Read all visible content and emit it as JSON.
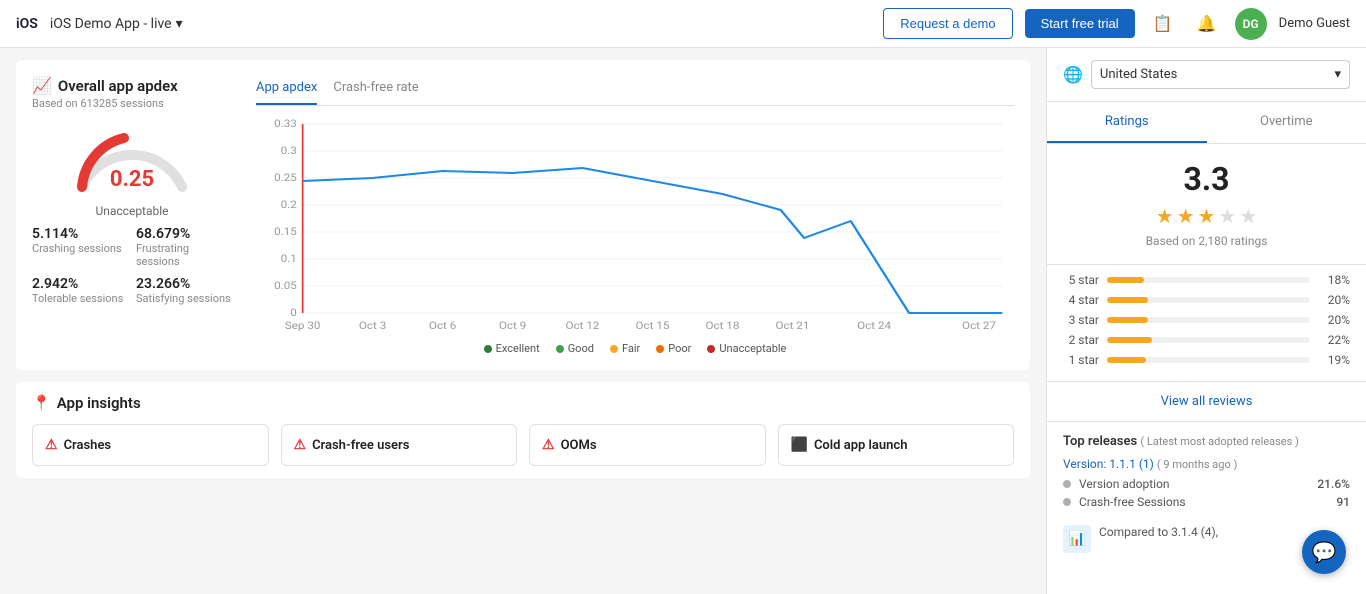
{
  "topnav": {
    "platform": "iOS",
    "app_name": "iOS Demo App - live",
    "demo_btn": "Request a demo",
    "trial_btn": "Start free trial",
    "user_initials": "DG",
    "user_name": "Demo Guest"
  },
  "apdex": {
    "title": "Overall app apdex",
    "subtitle": "Based on 613285 sessions",
    "value": "0.25",
    "label": "Unacceptable",
    "stats": [
      {
        "val": "5.114%",
        "lbl": "Crashing sessions"
      },
      {
        "val": "68.679%",
        "lbl": "Frustrating sessions"
      },
      {
        "val": "2.942%",
        "lbl": "Tolerable sessions"
      },
      {
        "val": "23.266%",
        "lbl": "Satisfying sessions"
      }
    ],
    "tabs": [
      {
        "label": "App apdex",
        "active": true
      },
      {
        "label": "Crash-free rate",
        "active": false
      }
    ],
    "x_labels": [
      "Sep 30",
      "Oct 3",
      "Oct 6",
      "Oct 9",
      "Oct 12",
      "Oct 15",
      "Oct 18",
      "Oct 21",
      "Oct 24",
      "Oct 27"
    ],
    "y_labels": [
      "0.33",
      "0.3",
      "0.25",
      "0.2",
      "0.15",
      "0.1",
      "0.05",
      "0"
    ],
    "legend": [
      {
        "label": "Excellent",
        "color": "#2e7d32"
      },
      {
        "label": "Good",
        "color": "#43a047"
      },
      {
        "label": "Fair",
        "color": "#f9a825"
      },
      {
        "label": "Poor",
        "color": "#ef6c00"
      },
      {
        "label": "Unacceptable",
        "color": "#c62828"
      }
    ]
  },
  "insights": {
    "title": "App insights",
    "cards": [
      {
        "label": "Crashes",
        "icon": "alert"
      },
      {
        "label": "Crash-free users",
        "icon": "alert"
      },
      {
        "label": "OOMs",
        "icon": "alert"
      },
      {
        "label": "Cold app launch",
        "icon": "box"
      }
    ]
  },
  "sidebar": {
    "country": "United States",
    "tabs": [
      {
        "label": "Ratings",
        "active": true
      },
      {
        "label": "Overtime",
        "active": false
      }
    ],
    "rating": {
      "value": "3.3",
      "stars": [
        true,
        true,
        true,
        false,
        false
      ],
      "subtitle": "Based on 2,180 ratings"
    },
    "star_bars": [
      {
        "label": "5 star",
        "pct": 18,
        "display": "18%"
      },
      {
        "label": "4 star",
        "pct": 20,
        "display": "20%"
      },
      {
        "label": "3 star",
        "pct": 20,
        "display": "20%"
      },
      {
        "label": "2 star",
        "pct": 22,
        "display": "22%"
      },
      {
        "label": "1 star",
        "pct": 19,
        "display": "19%"
      }
    ],
    "view_reviews": "View all reviews",
    "top_releases_title": "Top releases",
    "top_releases_sub": "( Latest most adopted releases )",
    "version": "Version: 1.1.1 (1)",
    "version_age": "( 9 months ago )",
    "release_rows": [
      {
        "label": "Version adoption",
        "value": "21.6%"
      },
      {
        "label": "Crash-free Sessions",
        "value": "91"
      }
    ],
    "compared_text": "Compared to 3.1.4 (4),"
  }
}
